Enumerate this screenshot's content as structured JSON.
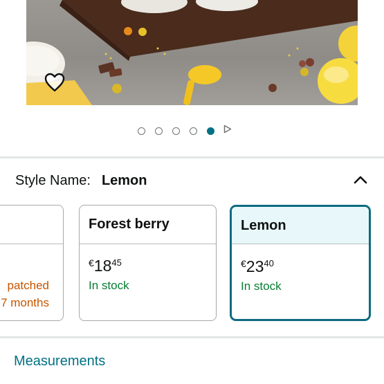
{
  "carousel": {
    "image_count": 5,
    "active_index": 4,
    "favorite_icon": "heart-outline-icon",
    "next_icon": "play-triangle-icon"
  },
  "style_selector": {
    "label": "Style Name:",
    "selected_value": "Lemon",
    "collapse_icon": "chevron-up-icon"
  },
  "swatches": [
    {
      "name": "",
      "status_line1": "patched",
      "status_line2": "7 months",
      "status_color": "#c45500"
    },
    {
      "name": "Forest berry",
      "price_currency": "€",
      "price_whole": "18",
      "price_fraction": "45",
      "availability": "In stock"
    },
    {
      "name": "Lemon",
      "price_currency": "€",
      "price_whole": "23",
      "price_fraction": "40",
      "availability": "In stock",
      "selected": true
    }
  ],
  "links": {
    "measurements": "Measurements"
  },
  "colors": {
    "accent_teal": "#007185",
    "selected_border": "#0d6b80",
    "selected_header_bg": "#e8f8fa",
    "in_stock_green": "#067d32"
  }
}
